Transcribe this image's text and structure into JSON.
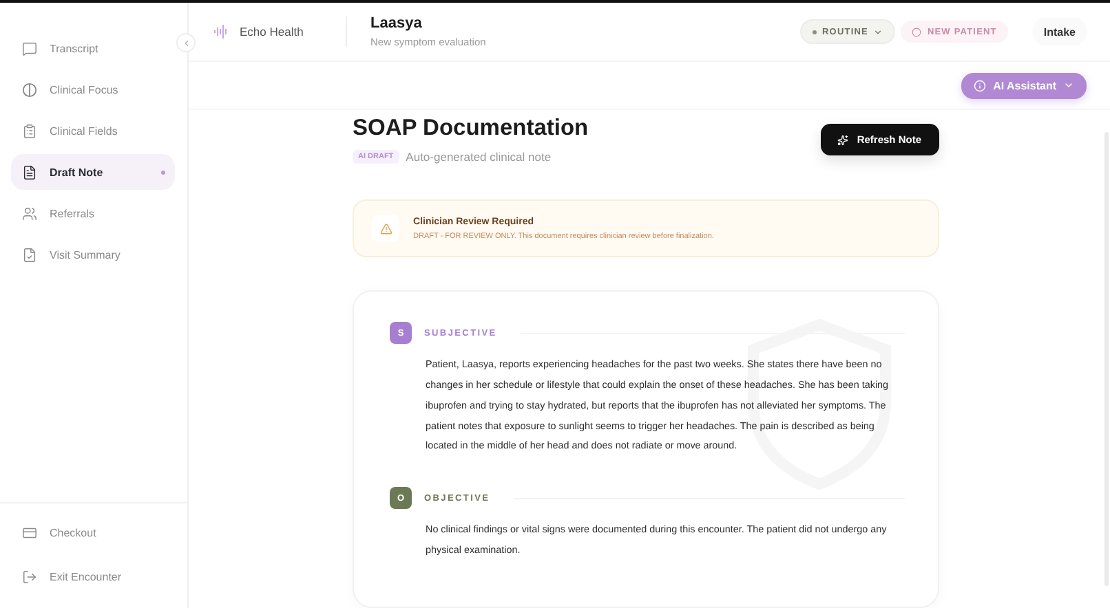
{
  "sidebar": {
    "items": [
      {
        "label": "Transcript",
        "selected": false
      },
      {
        "label": "Clinical Focus",
        "selected": false
      },
      {
        "label": "Clinical Fields",
        "selected": false
      },
      {
        "label": "Draft Note",
        "selected": true
      },
      {
        "label": "Referrals",
        "selected": false
      },
      {
        "label": "Visit Summary",
        "selected": false
      }
    ],
    "footer": [
      {
        "label": "Checkout"
      },
      {
        "label": "Exit Encounter"
      }
    ]
  },
  "header": {
    "brand": "Echo Health",
    "patient": "Laasya",
    "subtitle": "New symptom evaluation",
    "priority": "ROUTINE",
    "new_patient": {
      "label": "NEW PATIENT",
      "on": false
    },
    "intake": "Intake"
  },
  "assistant": {
    "label": "AI Assistant"
  },
  "document": {
    "title": "SOAP Documentation",
    "badge": "AI DRAFT",
    "subtitle": "Auto-generated clinical note",
    "refresh": "Refresh Note",
    "alert": {
      "title": "Clinician Review Required",
      "text": "DRAFT - FOR REVIEW ONLY. This document requires clinician review before finalization."
    },
    "sections": [
      {
        "letter": "S",
        "title": "SUBJECTIVE",
        "color": "#a77fd1",
        "body": "Patient, Laasya, reports experiencing headaches for the past two weeks. She states there have been no changes in her schedule or lifestyle that could explain the onset of these headaches. She has been taking ibuprofen and trying to stay hydrated, but reports that the ibuprofen has not alleviated her symptoms. The patient notes that exposure to sunlight seems to trigger her headaches. The pain is described as being located in the middle of her head and does not radiate or move around."
      },
      {
        "letter": "O",
        "title": "OBJECTIVE",
        "color": "#6b7a55",
        "body": "No clinical findings or vital signs were documented during this encounter. The patient did not undergo any physical examination."
      }
    ]
  }
}
